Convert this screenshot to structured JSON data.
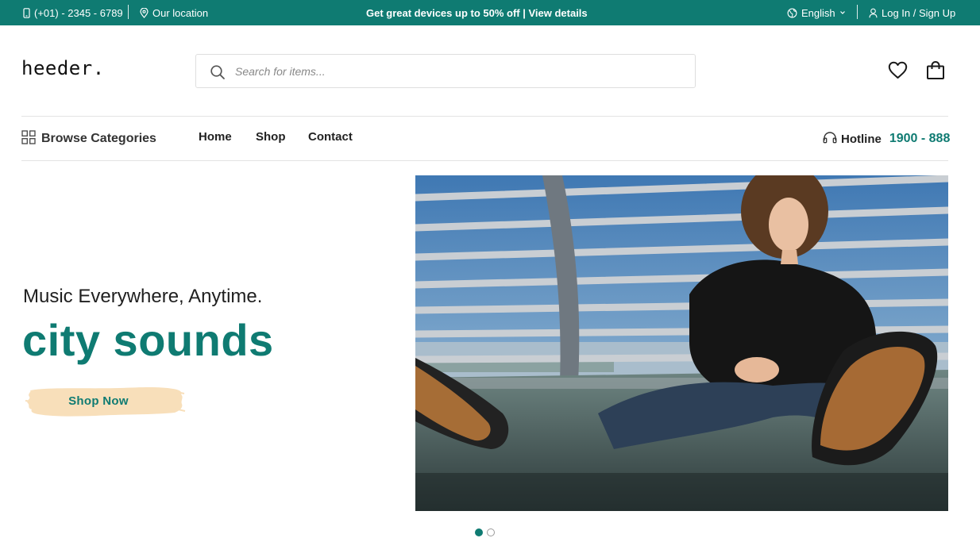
{
  "topbar": {
    "phone": "(+01) - 2345 - 6789",
    "location": "Our location",
    "promo": "Get great devices up to 50% off | View details",
    "language": "English",
    "auth": "Log In / Sign Up"
  },
  "header": {
    "logo": "heeder.",
    "search_placeholder": "Search for items..."
  },
  "nav": {
    "browse": "Browse Categories",
    "menu": [
      "Home",
      "Shop",
      "Contact"
    ],
    "hotline_label": "Hotline",
    "hotline_number": "1900 - 888"
  },
  "hero": {
    "subtitle": "Music Everywhere, Anytime.",
    "title": "city sounds",
    "cta": "Shop Now",
    "slide_count": 2,
    "active_slide": 1
  },
  "colors": {
    "brand": "#0f7b72",
    "cta_background": "#f8dfba"
  },
  "icons": [
    "phone-icon",
    "location-pin-icon",
    "globe-icon",
    "chevron-down-icon",
    "user-icon",
    "search-icon",
    "heart-icon",
    "shopping-bag-icon",
    "grid-icon",
    "headphones-icon"
  ]
}
